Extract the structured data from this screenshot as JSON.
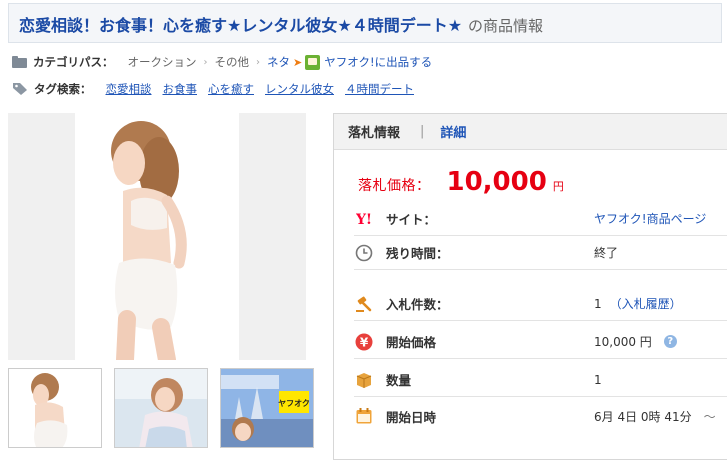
{
  "page_title": {
    "main": "恋愛相談！お食事！心を癒す★レンタル彼女★４時間デート★",
    "suffix": "の商品情報"
  },
  "category_path": {
    "label": "カテゴリパス：",
    "crumbs": [
      "オークション",
      "その他",
      "ネタ"
    ],
    "sell_link": "ヤフオク!に出品する"
  },
  "tag_search": {
    "label": "タグ検索：",
    "tags": [
      "恋愛相談",
      "お食事",
      "心を癒す",
      "レンタル彼女",
      "４時間デート"
    ]
  },
  "thumbnails": [
    {
      "icon": "thumbnail-photo-1"
    },
    {
      "icon": "thumbnail-photo-2"
    },
    {
      "icon": "thumbnail-photo-3",
      "badge": "ヤフオク"
    }
  ],
  "panel": {
    "tab_active": "落札情報",
    "tab_divider": "|",
    "tab_link": "詳細",
    "price_label": "落札価格：",
    "price_value": "10,000",
    "price_unit": "円",
    "rows": [
      {
        "icon": "yahoo-logo-icon",
        "label": "サイト：",
        "value": "ヤフオク!商品ページ"
      },
      {
        "icon": "clock-icon",
        "label": "残り時間：",
        "value": "終了"
      },
      {
        "icon": "gavel-icon",
        "label": "入札件数：",
        "value": "1",
        "extra": "（入札履歴）"
      },
      {
        "icon": "yen-icon",
        "label": "開始価格",
        "value": "10,000 円"
      },
      {
        "icon": "box-icon",
        "label": "数量",
        "value": "1"
      },
      {
        "icon": "calendar-icon",
        "label": "開始日時",
        "value": "6月 4日 0時 41分",
        "extra": "～"
      }
    ]
  },
  "colors": {
    "title": "#1b4aa5",
    "link": "#1f55b7",
    "price": "#e60012",
    "sell_arrow": "#ef7d12",
    "icon_orange": "#f39a1e",
    "yahoo_red": "#ff0033"
  }
}
